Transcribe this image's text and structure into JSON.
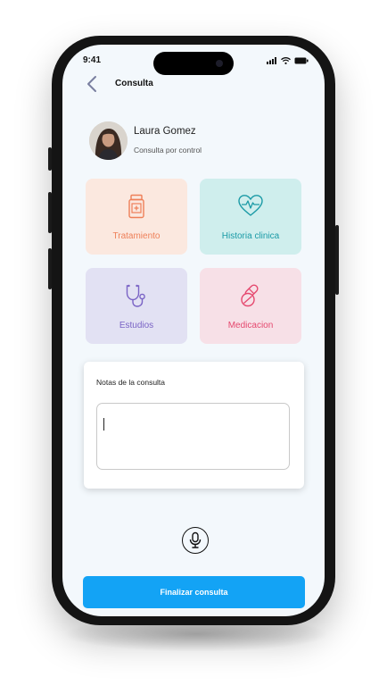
{
  "status_bar": {
    "time": "9:41"
  },
  "header": {
    "title": "Consulta"
  },
  "patient": {
    "name": "Laura Gomez",
    "subtitle": "Consulta por control"
  },
  "tiles": [
    {
      "label": "Tratamiento",
      "icon": "medicine-bottle-icon"
    },
    {
      "label": "Historia clinica",
      "icon": "heart-pulse-icon"
    },
    {
      "label": "Estudios",
      "icon": "stethoscope-icon"
    },
    {
      "label": "Medicacion",
      "icon": "pills-icon"
    }
  ],
  "notes": {
    "title": "Notas de la consulta",
    "value": "",
    "placeholder": ""
  },
  "actions": {
    "finish_label": "Finalizar consulta"
  },
  "colors": {
    "accent": "#13a3f5",
    "tratamiento": "#ee7f58",
    "historia": "#1a9aa6",
    "estudios": "#7a63c5",
    "medicacion": "#e5486e"
  }
}
